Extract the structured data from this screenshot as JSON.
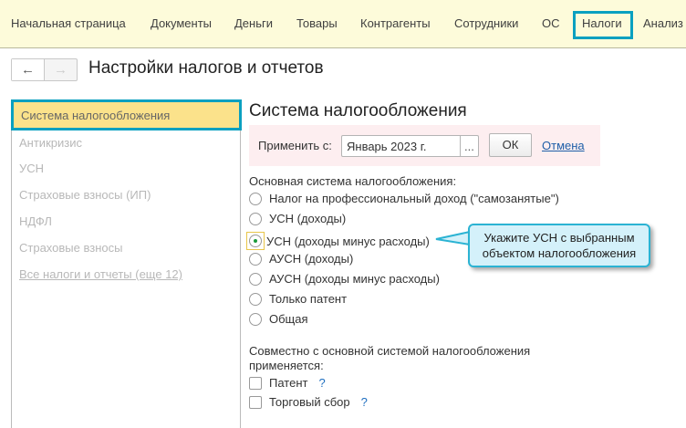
{
  "menu": [
    "Начальная страница",
    "Документы",
    "Деньги",
    "Товары",
    "Контрагенты",
    "Сотрудники",
    "ОС",
    "Налоги",
    "Анализ"
  ],
  "page_title": "Настройки налогов и отчетов",
  "sidebar": {
    "selected": "Система налогообложения",
    "items": [
      "Антикризис",
      "УСН",
      "Страховые взносы (ИП)",
      "НДФЛ",
      "Страховые взносы"
    ],
    "all_link": "Все налоги и отчеты (еще 12)"
  },
  "section_title": "Система налогообложения",
  "apply": {
    "label": "Применить с:",
    "value": "Январь 2023 г.",
    "dots": "...",
    "ok": "ОК",
    "cancel": "Отмена"
  },
  "main_system_label": "Основная система налогообложения:",
  "radios": [
    "Налог на профессиональный доход (\"самозанятые\")",
    "УСН (доходы)",
    "УСН (доходы минус расходы)",
    "АУСН (доходы)",
    "АУСН (доходы минус расходы)",
    "Только патент",
    "Общая"
  ],
  "selected_radio": "УСН (доходы минус расходы)",
  "joint_label": "Совместно с основной системой налогообложения применяется:",
  "checkboxes": [
    {
      "label": "Патент",
      "checked": false,
      "help": "?"
    },
    {
      "label": "Торговый сбор",
      "checked": false,
      "help": "?"
    }
  ],
  "callout": "Укажите УСН с выбранным объектом налогообложения",
  "nav": {
    "back": "←",
    "forward": "→"
  }
}
